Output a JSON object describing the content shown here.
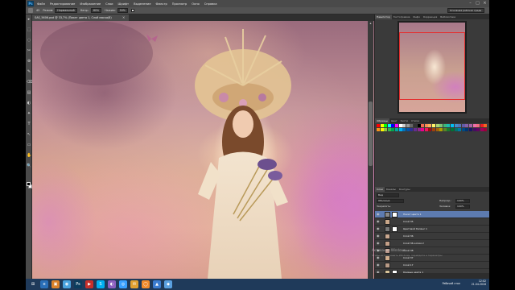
{
  "app": {
    "logo": "Ps",
    "menu": [
      "Файл",
      "Редактирование",
      "Изображение",
      "Слои",
      "Шрифт",
      "Выделение",
      "Фильтр",
      "Просмотр",
      "Окно",
      "Справка"
    ],
    "window_controls": {
      "minimize": "–",
      "maximize": "□",
      "close": "×"
    }
  },
  "options_bar": {
    "label_brush_size": "45",
    "label_mode": "Режим:",
    "mode_value": "Нормальный",
    "label_opacity": "Непр.:",
    "opacity_value": "80%",
    "label_flow": "Нажим:",
    "flow_value": "50%",
    "workspace": "Основная рабочая среда"
  },
  "document": {
    "tab_title": "SAS_5606.psd @ 33,7% (Пакет цвета 1, Слой маска/8)",
    "tab_close": "×"
  },
  "tools": [
    "▸",
    "⬚",
    "◌",
    "✂",
    "⊕",
    "✎",
    "⌫",
    "▤",
    "◐",
    "✦",
    "T",
    "↖",
    "▭",
    "✋",
    "🔍"
  ],
  "panels": {
    "top_tabs": [
      "Навигатор",
      "Гистограмма",
      "Инфо",
      "Коррекция",
      "Библиотеки"
    ],
    "swatch_tabs": [
      "Образцы",
      "Цвет",
      "Кисти",
      "Стили"
    ],
    "swatch_colors": [
      "#ff0000",
      "#ffff00",
      "#00ff00",
      "#00ffff",
      "#0000ff",
      "#ff00ff",
      "#ffffff",
      "#cccccc",
      "#999999",
      "#666666",
      "#333333",
      "#000000",
      "#f26c4f",
      "#f68e55",
      "#fbaf5c",
      "#fff467",
      "#acd372",
      "#7cc576",
      "#3bb878",
      "#1abbb4",
      "#00bff3",
      "#438ccb",
      "#5574b9",
      "#605ca8",
      "#855fa8",
      "#a763a8",
      "#f06ea9",
      "#f26d7d",
      "#ed1c24",
      "#f26522",
      "#f7941d",
      "#fff200",
      "#8dc73f",
      "#39b54a",
      "#00a651",
      "#00a99d",
      "#00aeef",
      "#0072bc",
      "#0054a6",
      "#2e3192",
      "#662d91",
      "#92278f",
      "#ec008c",
      "#ed145b",
      "#9e0b0f",
      "#a0410d",
      "#a3620a",
      "#aba000",
      "#598527",
      "#197b30",
      "#007236",
      "#00746b",
      "#0076a3",
      "#004a80",
      "#003471",
      "#1b1464",
      "#440e62",
      "#630460",
      "#9e005d",
      "#9e0039"
    ],
    "layers_tabs": [
      "Слои",
      "Каналы",
      "Контуры"
    ],
    "layers_kind": "Вид",
    "layers_blend": "Обычные",
    "layers_opacity_label": "Непрозр.:",
    "layers_opacity": "100%",
    "layers_lock_label": "Закрепить:",
    "layers_fill_label": "Заливка:",
    "layers_fill": "100%",
    "layers": [
      {
        "name": "Пакет цвета 1",
        "selected": true,
        "thumb": "#888888",
        "mask": "#ffffff"
      },
      {
        "name": "Слой 35",
        "selected": false,
        "thumb": "#c9a78a",
        "mask": ""
      },
      {
        "name": "Цветовой баланс 1",
        "selected": false,
        "thumb": "#777777",
        "mask": "#ffffff"
      },
      {
        "name": "Слой 36",
        "selected": false,
        "thumb": "#caa890",
        "mask": ""
      },
      {
        "name": "Слой 36 копия 2",
        "selected": false,
        "thumb": "#c4a088",
        "mask": ""
      },
      {
        "name": "Слой 38",
        "selected": false,
        "thumb": "#b9978a",
        "mask": ""
      },
      {
        "name": "Слой 37",
        "selected": false,
        "thumb": "#d0ad8d",
        "mask": ""
      },
      {
        "name": "Слой 17",
        "selected": false,
        "thumb": "#b89a86",
        "mask": ""
      },
      {
        "name": "Кривые цвета 1",
        "selected": false,
        "thumb": "#d8c49a",
        "mask": "#ffffff"
      }
    ]
  },
  "watermark": {
    "title": "Активация Windows",
    "subtitle": "Чтобы активировать Windows, перейдите в параметры"
  },
  "taskbar": {
    "start": "⊞",
    "apps": [
      {
        "icon": "e",
        "color": "#2a6fb8"
      },
      {
        "icon": "▣",
        "color": "#d9822b"
      },
      {
        "icon": "◉",
        "color": "#4aa3df"
      },
      {
        "icon": "Ps",
        "color": "#0b3c5d"
      },
      {
        "icon": "▶",
        "color": "#c7302b"
      },
      {
        "icon": "S",
        "color": "#00aff0"
      },
      {
        "icon": "◐",
        "color": "#8a5fbf"
      },
      {
        "icon": "◎",
        "color": "#3aa1ff"
      },
      {
        "icon": "✉",
        "color": "#e0a030"
      },
      {
        "icon": "◯",
        "color": "#f28b2b"
      },
      {
        "icon": "▲",
        "color": "#3b7ccf"
      },
      {
        "icon": "◆",
        "color": "#5aa0e0"
      }
    ],
    "language": "Рабочий стол",
    "time": "12:02",
    "date": "21.04.2016"
  }
}
